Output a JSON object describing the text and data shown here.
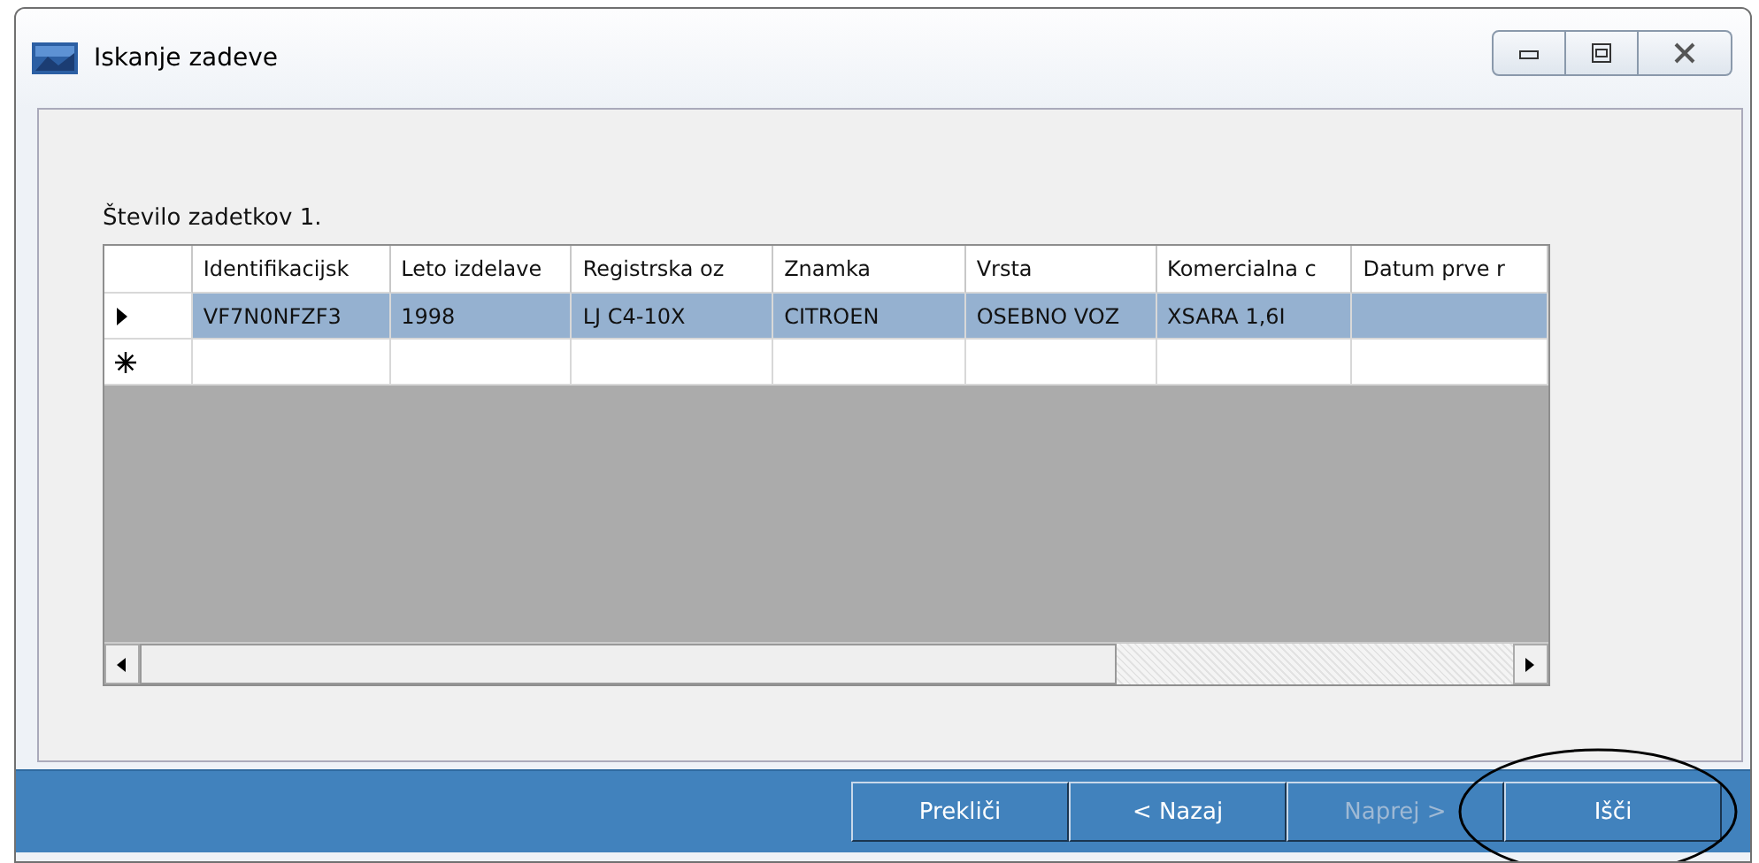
{
  "window": {
    "title": "Iskanje zadeve"
  },
  "result_count": "Število zadetkov 1.",
  "table": {
    "columns": [
      "Identifikacijsk",
      "Leto izdelave",
      "Registrska oz",
      "Znamka",
      "Vrsta",
      "Komercialna c",
      "Datum prve r"
    ],
    "rows": [
      {
        "kind": "data",
        "selected": true,
        "cells": [
          "VF7N0NFZF3",
          "1998",
          "LJ C4-10X",
          "CITROEN",
          "OSEBNO VOZ",
          "XSARA 1,6I",
          ""
        ]
      },
      {
        "kind": "new",
        "selected": false,
        "cells": [
          "",
          "",
          "",
          "",
          "",
          "",
          ""
        ]
      }
    ]
  },
  "buttons": [
    {
      "label": "Prekliči",
      "disabled": false,
      "circled": false
    },
    {
      "label": "< Nazaj",
      "disabled": false,
      "circled": false
    },
    {
      "label": "Naprej >",
      "disabled": true,
      "circled": false
    },
    {
      "label": "Išči",
      "disabled": false,
      "circled": true
    }
  ]
}
